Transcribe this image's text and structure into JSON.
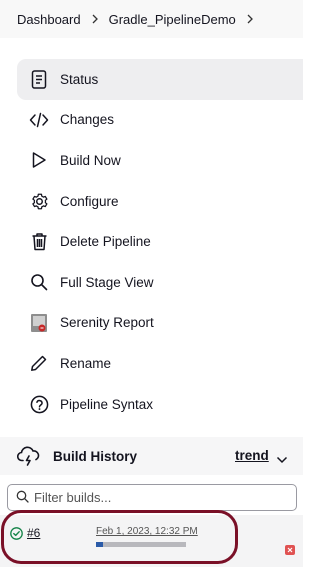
{
  "breadcrumb": {
    "items": [
      "Dashboard",
      "Gradle_PipelineDemo"
    ]
  },
  "menu": {
    "items": [
      {
        "label": "Status",
        "icon": "status-icon",
        "active": true
      },
      {
        "label": "Changes",
        "icon": "code-icon"
      },
      {
        "label": "Build Now",
        "icon": "play-icon"
      },
      {
        "label": "Configure",
        "icon": "gear-icon"
      },
      {
        "label": "Delete Pipeline",
        "icon": "trash-icon"
      },
      {
        "label": "Full Stage View",
        "icon": "search-icon"
      },
      {
        "label": "Serenity Report",
        "icon": "serenity-icon"
      },
      {
        "label": "Rename",
        "icon": "pencil-icon"
      },
      {
        "label": "Pipeline Syntax",
        "icon": "help-icon"
      }
    ]
  },
  "build_history": {
    "title": "Build History",
    "trend_label": "trend",
    "filter_placeholder": "Filter builds...",
    "builds": [
      {
        "number": "#6",
        "date": "Feb 1, 2023, 12:32 PM",
        "status": "success",
        "progress": 0.08
      }
    ]
  },
  "colors": {
    "accent": "#2b5ba8",
    "highlight": "#7a1027",
    "success": "#138347",
    "cancel": "#e05252"
  }
}
